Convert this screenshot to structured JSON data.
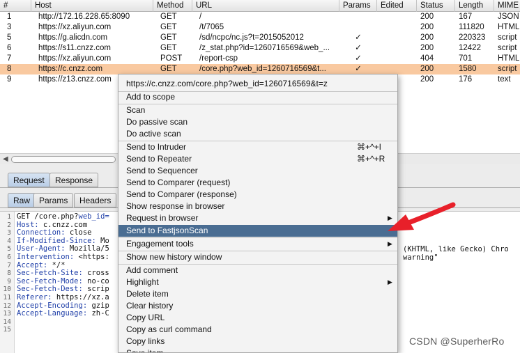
{
  "table": {
    "columns": [
      "#",
      "Host",
      "Method",
      "URL",
      "Params",
      "Edited",
      "Status",
      "Length",
      "MIME t"
    ],
    "rows": [
      {
        "num": "1",
        "host": "http://172.16.228.65:8090",
        "method": "GET",
        "url": "/",
        "params": "",
        "edited": "",
        "status": "200",
        "length": "167",
        "mime": "JSON"
      },
      {
        "num": "3",
        "host": "https://xz.aliyun.com",
        "method": "GET",
        "url": "/t/7065",
        "params": "",
        "edited": "",
        "status": "200",
        "length": "111820",
        "mime": "HTML"
      },
      {
        "num": "5",
        "host": "https://g.alicdn.com",
        "method": "GET",
        "url": "/sd/ncpc/nc.js?t=2015052012",
        "params": "✓",
        "edited": "",
        "status": "200",
        "length": "220323",
        "mime": "script"
      },
      {
        "num": "6",
        "host": "https://s11.cnzz.com",
        "method": "GET",
        "url": "/z_stat.php?id=1260716569&web_...",
        "params": "✓",
        "edited": "",
        "status": "200",
        "length": "12422",
        "mime": "script"
      },
      {
        "num": "7",
        "host": "https://xz.aliyun.com",
        "method": "POST",
        "url": "/report-csp",
        "params": "✓",
        "edited": "",
        "status": "404",
        "length": "701",
        "mime": "HTML"
      },
      {
        "num": "8",
        "host": "https://c.cnzz.com",
        "method": "GET",
        "url": "/core.php?web_id=1260716569&t...",
        "params": "✓",
        "edited": "",
        "status": "200",
        "length": "1580",
        "mime": "script"
      },
      {
        "num": "9",
        "host": "https://z13.cnzz.com",
        "method": "GET",
        "url": "",
        "params": "",
        "edited": "",
        "status": "200",
        "length": "176",
        "mime": "text"
      }
    ],
    "selected_row": 5
  },
  "tabs": {
    "message": [
      "Request",
      "Response"
    ],
    "view": [
      "Raw",
      "Params",
      "Headers"
    ]
  },
  "editor": {
    "line_numbers": [
      "1",
      "2",
      "3",
      "4",
      "5",
      "6",
      "7",
      "8",
      "9",
      "10",
      "11",
      "12",
      "13",
      "14",
      "15"
    ],
    "lines": [
      {
        "pre": "GET /core.php?",
        "key": "web_id=",
        "val": ""
      },
      {
        "key": "Host:",
        "val": " c.cnzz.com"
      },
      {
        "key": "Connection:",
        "val": " close"
      },
      {
        "key": "If-Modified-Since:",
        "val": " Mo"
      },
      {
        "key": "User-Agent:",
        "val": " Mozilla/5"
      },
      {
        "key": "Intervention:",
        "val": " <https:"
      },
      {
        "key": "Accept:",
        "val": " */*"
      },
      {
        "key": "Sec-Fetch-Site:",
        "val": " cross"
      },
      {
        "key": "Sec-Fetch-Mode:",
        "val": " no-co"
      },
      {
        "key": "Sec-Fetch-Dest:",
        "val": " scrip"
      },
      {
        "key": "Referer:",
        "val": " https://xz.a"
      },
      {
        "key": "Accept-Encoding:",
        "val": " gzip"
      },
      {
        "key": "Accept-Language:",
        "val": " zh-C"
      }
    ],
    "line5_tail": "(KHTML, like Gecko) Chro",
    "line6_tail": "warning\""
  },
  "menu": {
    "url_header": "https://c.cnzz.com/core.php?web_id=1260716569&t=z",
    "items": {
      "add_to_scope": "Add to scope",
      "scan": "Scan",
      "passive_scan": "Do passive scan",
      "active_scan": "Do active scan",
      "intruder": "Send to Intruder",
      "intruder_shortcut": "⌘+^+I",
      "repeater": "Send to Repeater",
      "repeater_shortcut": "⌘+^+R",
      "sequencer": "Send to Sequencer",
      "comparer_request": "Send to Comparer (request)",
      "comparer_response": "Send to Comparer (response)",
      "show_response": "Show response in browser",
      "request_in_browser": "Request in browser",
      "fastjsonscan": "Send to FastjsonScan",
      "engagement_tools": "Engagement tools",
      "new_history_window": "Show new history window",
      "add_comment": "Add comment",
      "highlight": "Highlight",
      "delete_item": "Delete item",
      "clear_history": "Clear history",
      "copy_url": "Copy URL",
      "copy_curl": "Copy as curl command",
      "copy_links": "Copy links",
      "save_item": "Save item"
    },
    "highlight_color": "#4a6d92"
  },
  "colors": {
    "selected_row": "#f9c9a0",
    "annotation_arrow": "#e8202a",
    "header_key": "#1f3fa8"
  },
  "watermark": "CSDN @SuperherRo",
  "icons": {
    "submenu": "chevron-right-icon",
    "params_check": "check-icon",
    "annotation": "red-arrow-icon"
  }
}
